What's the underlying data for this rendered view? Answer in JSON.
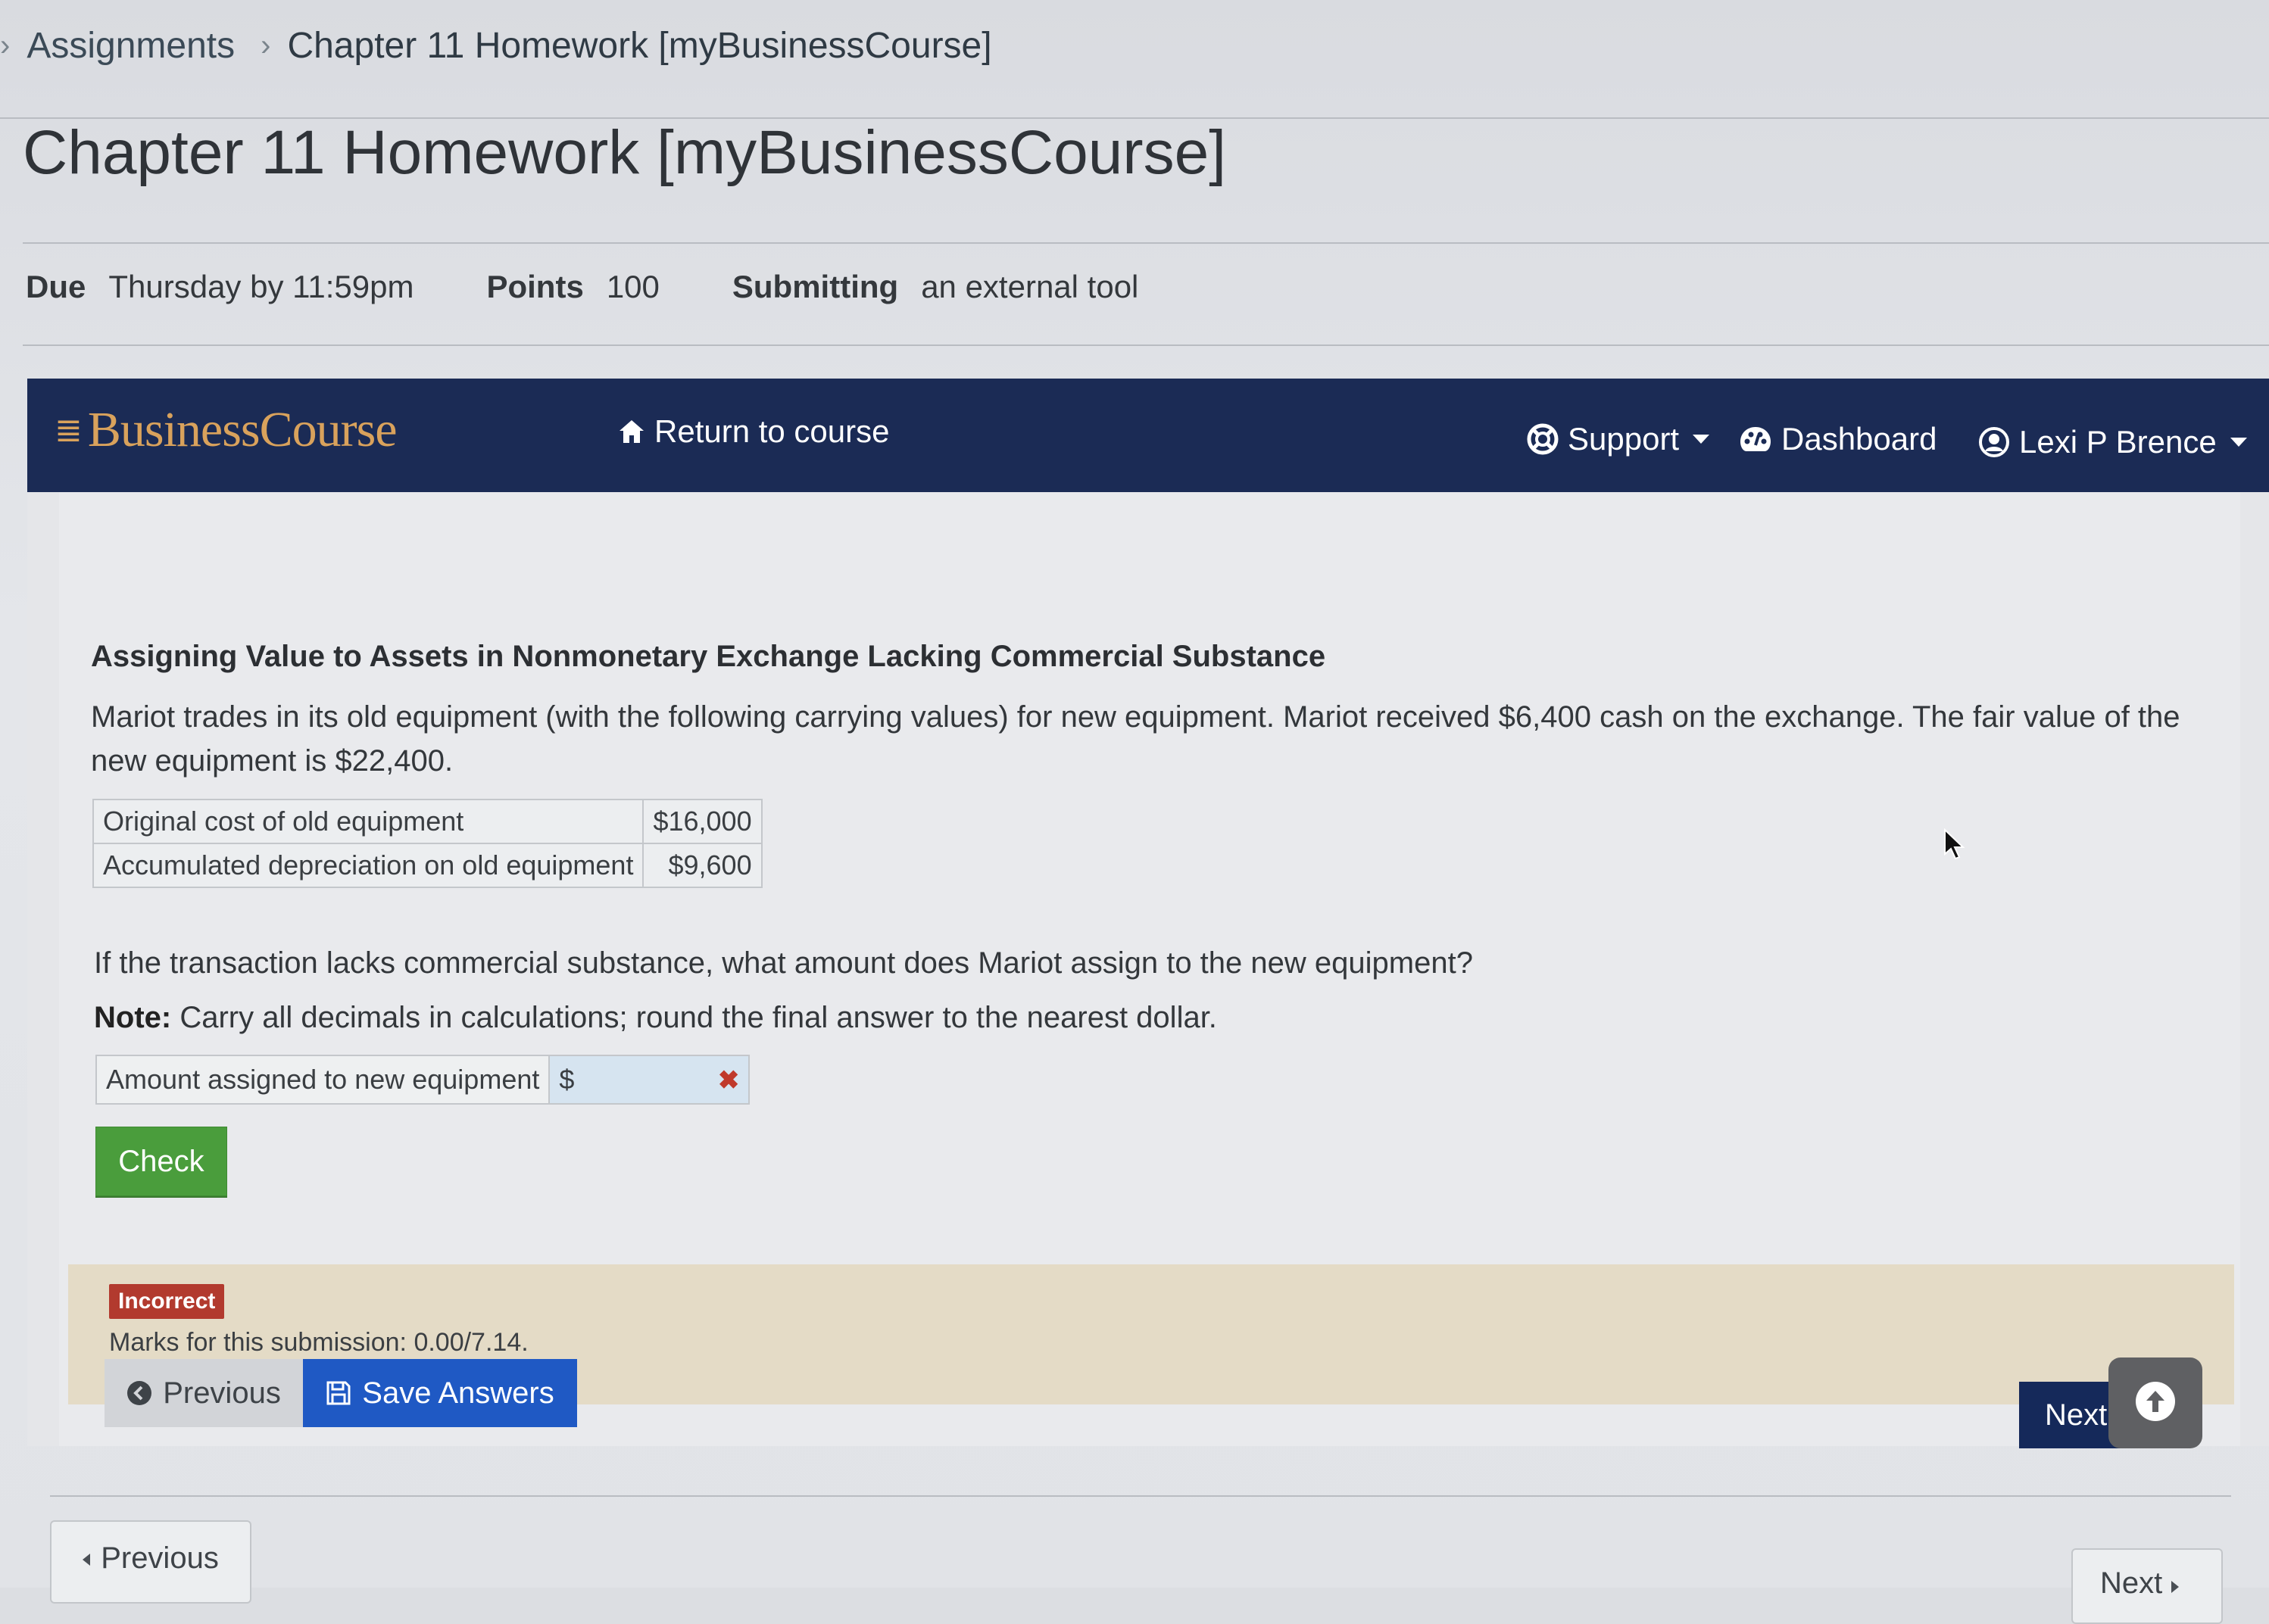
{
  "breadcrumb": {
    "items": [
      "Assignments",
      "Chapter 11 Homework [myBusinessCourse]"
    ]
  },
  "page": {
    "title": "Chapter 11 Homework [myBusinessCourse]"
  },
  "details": {
    "due_label": "Due",
    "due_value": "Thursday by 11:59pm",
    "points_label": "Points",
    "points_value": "100",
    "submitting_label": "Submitting",
    "submitting_value": "an external tool"
  },
  "topbar": {
    "brand": "BusinessCourse",
    "return_label": "Return to course",
    "support_label": "Support",
    "dashboard_label": "Dashboard",
    "user_name": "Lexi P Brence",
    "background_color": "#1b2b55",
    "brand_color": "#d9a25c"
  },
  "question": {
    "title": "Assigning Value to Assets in Nonmonetary Exchange Lacking Commercial Substance",
    "body": "Mariot trades in its old equipment (with the following carrying values) for new equipment. Mariot received $6,400 cash on the exchange. The fair value of the new equipment is $22,400.",
    "table": [
      {
        "label": "Original cost of old equipment",
        "value": "$16,000"
      },
      {
        "label": "Accumulated depreciation on old equipment",
        "value": "$9,600"
      }
    ],
    "prompt": "If the transaction lacks commercial substance, what amount does Mariot assign to the new equipment?",
    "note_label": "Note:",
    "note_text": " Carry all decimals in calculations; round the final answer to the nearest dollar.",
    "answer_label": "Amount assigned to new equipment",
    "currency_symbol": "$",
    "answer_value": "",
    "check_label": "Check"
  },
  "feedback": {
    "badge": "Incorrect",
    "marks": "Marks for this submission: 0.00/7.14.",
    "badge_color": "#b23a2e",
    "background_color": "#e4dbc6"
  },
  "actions": {
    "previous_label": "Previous",
    "save_label": "Save Answers",
    "next_label": "Next",
    "save_color": "#1f59c4",
    "next_color": "#15295a"
  },
  "footer": {
    "previous_label": "Previous",
    "next_label": "Next"
  },
  "icons": {
    "home": "home-icon",
    "support": "lifebuoy-icon",
    "dashboard": "palette-icon",
    "user": "user-circle-icon",
    "previous": "chevron-circle-left-icon",
    "save": "floppy-disk-icon",
    "scroll_top": "arrow-circle-up-icon",
    "clear": "close-icon"
  }
}
